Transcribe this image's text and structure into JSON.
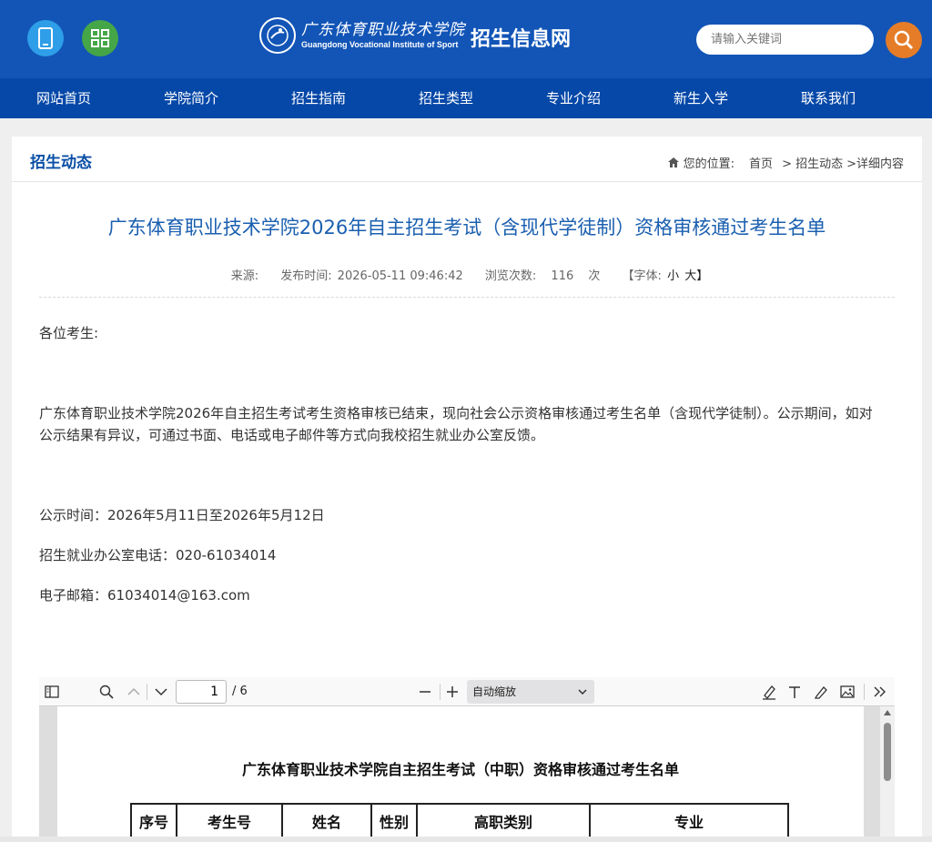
{
  "header": {
    "logo_cn": "广东体育职业技术学院",
    "logo_en": "Guangdong Vocational Institute of Sport",
    "site_title": "招生信息网",
    "search_placeholder": "请输入关键词",
    "mobile_icon": "mobile-phone-icon",
    "grid_icon": "app-grid-icon",
    "search_icon": "magnifier-icon"
  },
  "nav": {
    "items": [
      "网站首页",
      "学院简介",
      "招生指南",
      "招生类型",
      "专业介绍",
      "新生入学",
      "联系我们"
    ]
  },
  "section": {
    "title": "招生动态",
    "breadcrumb_label": "您的位置:",
    "breadcrumb": [
      "首页",
      "> 招生动态",
      ">详细内容"
    ]
  },
  "article": {
    "title": "广东体育职业技术学院2026年自主招生考试（含现代学徒制）资格审核通过考生名单",
    "source_label": "来源:",
    "publish_label": "发布时间:",
    "publish_time": "2026-05-11 09:46:42",
    "views_label": "浏览次数:",
    "views": "116",
    "views_unit": "次",
    "font_label": "【字体:",
    "font_small": "小",
    "font_big": "大】",
    "greeting": "各位考生:",
    "body": "广东体育职业技术学院2026年自主招生考试考生资格审核已结束，现向社会公示资格审核通过考生名单（含现代学徒制）。公示期间，如对公示结果有异议，可通过书面、电话或电子邮件等方式向我校招生就业办公室反馈。",
    "period": "公示时间：2026年5月11日至2026年5月12日",
    "phone": "招生就业办公室电话：020-61034014",
    "email": "电子邮箱：61034014@163.com"
  },
  "pdf_viewer": {
    "page_current": "1",
    "page_total": "/ 6",
    "zoom": "自动缩放",
    "doc_title": "广东体育职业技术学院自主招生考试（中职）资格审核通过考生名单",
    "columns": [
      "序号",
      "考生号",
      "姓名",
      "性别",
      "高职类别",
      "专业"
    ]
  },
  "colors": {
    "header_blue": "#1255b7",
    "nav_blue": "#0648a8",
    "title_blue": "#1a5fb0",
    "search_orange": "#e57c28"
  }
}
